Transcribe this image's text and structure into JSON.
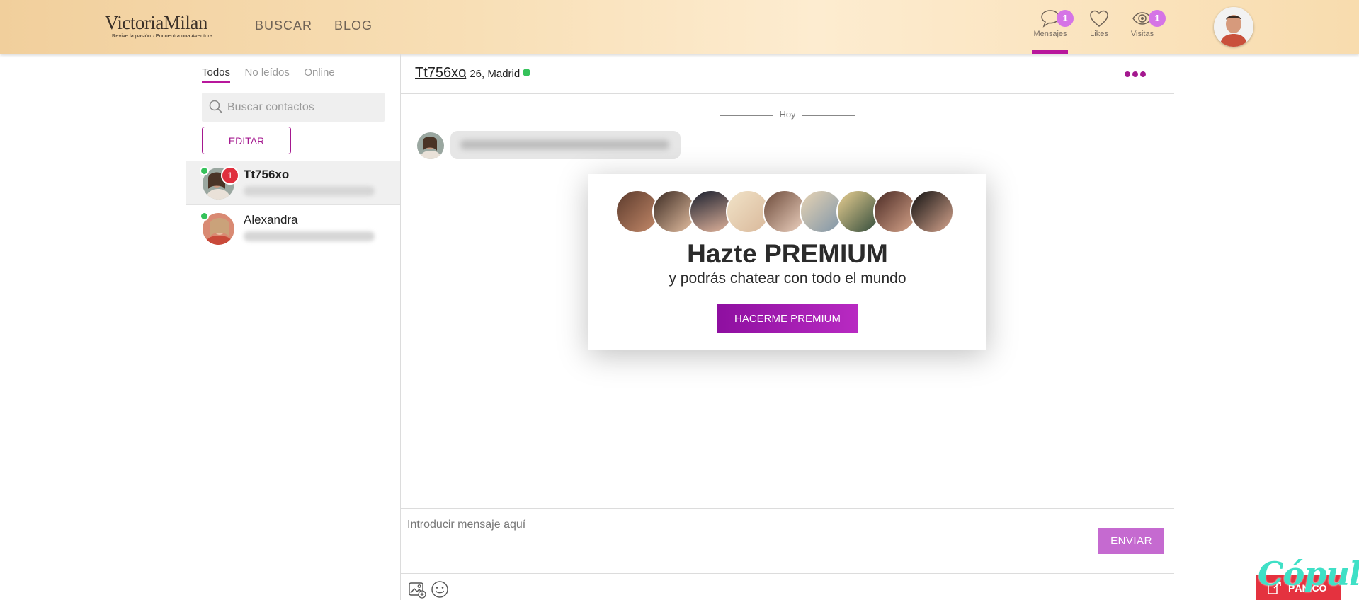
{
  "header": {
    "logo": {
      "brand": "VictoriaMilan",
      "tagline": "Revive la pasión · Encuentra una Aventura"
    },
    "nav": {
      "buscar": "BUSCAR",
      "blog": "BLOG"
    },
    "mensajes": {
      "label": "Mensajes",
      "badge": "1",
      "icon": "chat-bubble-icon"
    },
    "likes": {
      "label": "Likes",
      "icon": "heart-icon"
    },
    "visitas": {
      "label": "Visitas",
      "badge": "1",
      "icon": "eye-icon"
    }
  },
  "sidebar": {
    "tabs": [
      "Todos",
      "No leídos",
      "Online"
    ],
    "search": {
      "placeholder": "Buscar contactos"
    },
    "edit_label": "EDITAR",
    "contacts": [
      {
        "name": "Tt756xo",
        "badge": "1",
        "online": true,
        "unread": true
      },
      {
        "name": "Alexandra",
        "online": true,
        "unread": false
      }
    ]
  },
  "chat": {
    "name": "Tt756xo",
    "meta": ", 26, Madrid",
    "day_separator": "Hoy",
    "compose": {
      "placeholder": "Introducir mensaje aquí",
      "send_label": "ENVIAR"
    }
  },
  "premium": {
    "title": "Hazte PREMIUM",
    "subtitle": "y podrás chatear con todo el mundo",
    "button": "HACERME PREMIUM"
  },
  "panic": {
    "label": "PÁNICO"
  },
  "watermark": "Cópuli",
  "colors": {
    "accent": "#b8179c",
    "online": "#35c25a",
    "badge_red": "#e0303e",
    "badge_pink": "#d574e6",
    "panic": "#e4323f"
  }
}
